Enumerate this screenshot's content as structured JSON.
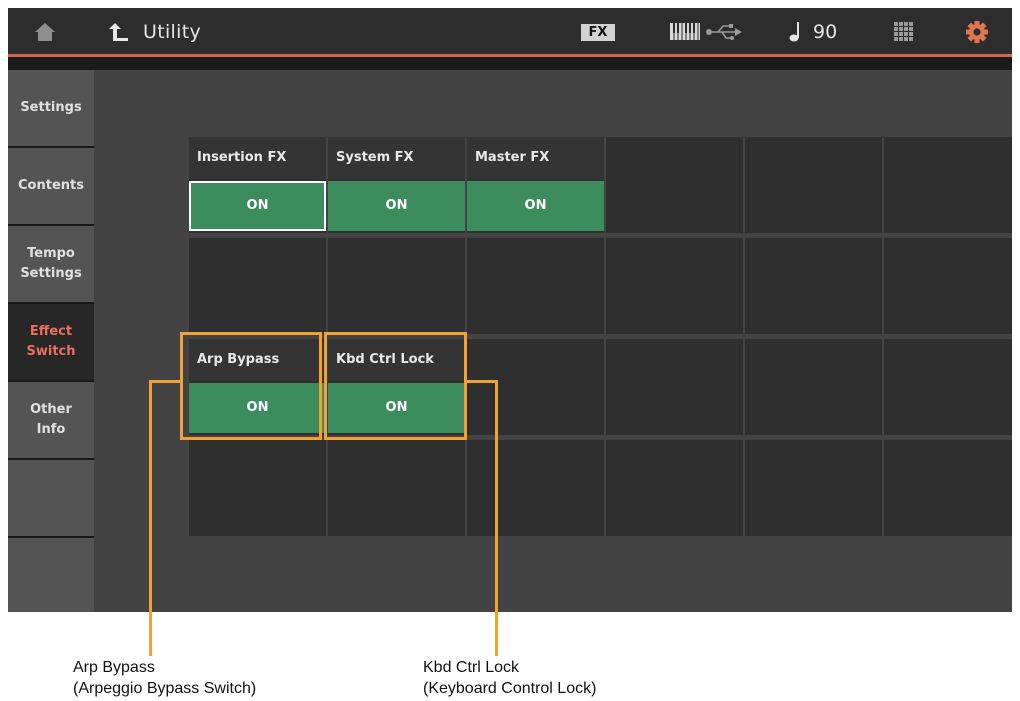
{
  "header": {
    "title": "Utility",
    "fx_badge": "FX",
    "tempo": "90",
    "icons": [
      "home-icon",
      "back-arrow-icon",
      "keyboard-icon",
      "usb-icon",
      "quarter-note-icon",
      "grid-icon",
      "gear-icon"
    ],
    "accent_color": "#d4684a"
  },
  "tabs": [
    {
      "label": "Settings"
    },
    {
      "label": "Contents"
    },
    {
      "label": "Tempo\nSettings"
    },
    {
      "label": "Effect\nSwitch",
      "active": true
    },
    {
      "label": "Other\nInfo"
    }
  ],
  "switches": {
    "insertion_fx": {
      "label": "Insertion FX",
      "value": "ON"
    },
    "system_fx": {
      "label": "System FX",
      "value": "ON"
    },
    "master_fx": {
      "label": "Master FX",
      "value": "ON"
    },
    "arp_bypass": {
      "label": "Arp Bypass",
      "value": "ON"
    },
    "kbd_ctrl_lock": {
      "label": "Kbd Ctrl Lock",
      "value": "ON"
    },
    "on_color": "#3c8c5e"
  },
  "callouts": {
    "arp_bypass": {
      "line1": "Arp Bypass",
      "line2": "(Arpeggio Bypass Switch)"
    },
    "kbd_ctrl_lock": {
      "line1": "Kbd Ctrl Lock",
      "line2": "(Keyboard Control Lock)"
    },
    "color": "#f0a237"
  }
}
